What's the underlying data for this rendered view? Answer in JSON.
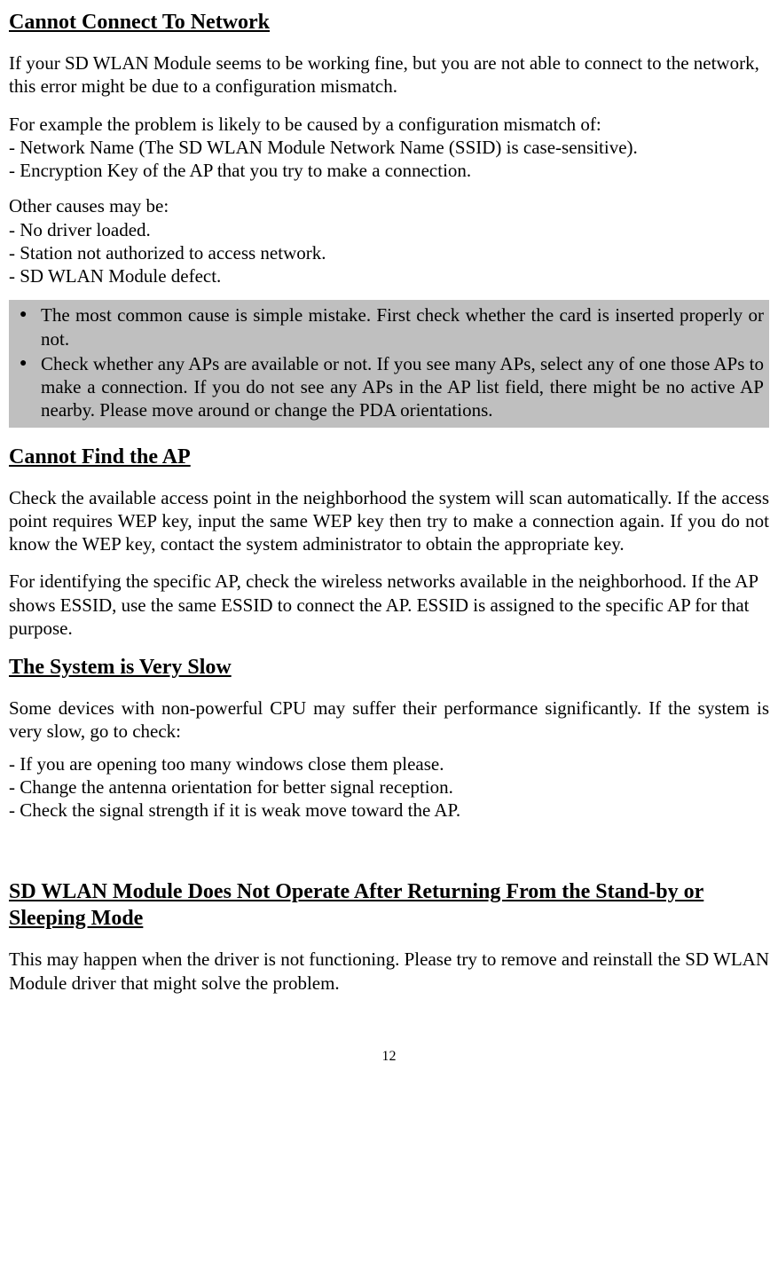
{
  "section1": {
    "heading": "Cannot Connect To Network",
    "p1": "If your SD WLAN Module seems to be working fine, but you are not able to connect to the network, this error might be due to a configuration mismatch.",
    "p2_intro": "For example the problem is likely to be caused by a configuration mismatch of:",
    "p2_item1": "- Network Name (The SD WLAN Module Network Name (SSID) is case-sensitive).",
    "p2_item2": "- Encryption Key of the AP that you try to make a connection.",
    "p3_intro": "Other causes may be:",
    "p3_item1": "- No driver loaded.",
    "p3_item2": "- Station not authorized to access network.",
    "p3_item3": "- SD WLAN Module defect.",
    "bullet1": "The most common cause is simple mistake. First check whether the card is inserted properly or not.",
    "bullet2": "Check whether any APs are available or not. If you see many APs, select any of one those APs to make a connection. If you do not see any APs in the AP list field, there might be no active AP nearby. Please move around or change the PDA orientations."
  },
  "section2": {
    "heading": "Cannot Find the AP",
    "p1": "Check the available access point in the neighborhood the system will scan automatically. If the access point requires WEP key, input the same WEP key then try to make a connection again. If you do not know the WEP key, contact the system administrator to obtain the appropriate key.",
    "p2": "For identifying the specific AP, check the wireless networks available in the neighborhood. If the AP shows ESSID, use the same ESSID to connect the AP. ESSID is assigned to the specific AP for that purpose."
  },
  "section3": {
    "heading": "The System is Very Slow",
    "p1": "Some devices with non-powerful CPU may suffer their performance significantly. If the system is very slow, go to check:",
    "item1": "- If you are opening too many windows close them please.",
    "item2": "- Change the antenna orientation for better signal reception.",
    "item3": "- Check the signal strength if it is weak move toward the AP."
  },
  "section4": {
    "heading": "SD WLAN Module Does Not Operate After Returning From the Stand-by or Sleeping Mode",
    "p1": "This may happen when the driver is not functioning. Please try to remove and reinstall the SD WLAN Module driver that might solve the problem."
  },
  "page_number": "12"
}
